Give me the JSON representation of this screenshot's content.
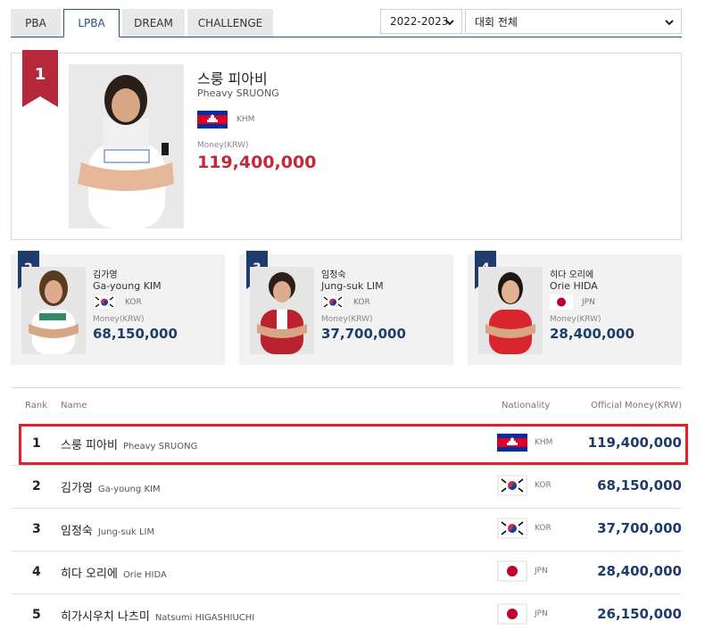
{
  "tabs": [
    {
      "label": "PBA",
      "active": false
    },
    {
      "label": "LPBA",
      "active": true
    },
    {
      "label": "DREAM",
      "active": false
    },
    {
      "label": "CHALLENGE",
      "active": false
    }
  ],
  "filters": {
    "season": "2022-2023",
    "tournament": "대회 전체"
  },
  "money_label": "Money(KRW)",
  "top": [
    {
      "rank": "1",
      "name_ko": "스룽 피아비",
      "name_en": "Pheavy SRUONG",
      "nat": "KHM",
      "money": "119,400,000"
    },
    {
      "rank": "2",
      "name_ko": "김가영",
      "name_en": "Ga-young KIM",
      "nat": "KOR",
      "money": "68,150,000"
    },
    {
      "rank": "3",
      "name_ko": "임정숙",
      "name_en": "Jung-suk LIM",
      "nat": "KOR",
      "money": "37,700,000"
    },
    {
      "rank": "4",
      "name_ko": "히다 오리에",
      "name_en": "Orie HIDA",
      "nat": "JPN",
      "money": "28,400,000"
    }
  ],
  "table": {
    "headers": {
      "rank": "Rank",
      "name": "Name",
      "nationality": "Nationality",
      "money": "Official Money(KRW)"
    },
    "rows": [
      {
        "rank": "1",
        "name_ko": "스룽 피아비",
        "name_en": "Pheavy SRUONG",
        "nat": "KHM",
        "money": "119,400,000"
      },
      {
        "rank": "2",
        "name_ko": "김가영",
        "name_en": "Ga-young KIM",
        "nat": "KOR",
        "money": "68,150,000"
      },
      {
        "rank": "3",
        "name_ko": "임정숙",
        "name_en": "Jung-suk LIM",
        "nat": "KOR",
        "money": "37,700,000"
      },
      {
        "rank": "4",
        "name_ko": "히다 오리에",
        "name_en": "Orie HIDA",
        "nat": "JPN",
        "money": "28,400,000"
      },
      {
        "rank": "5",
        "name_ko": "히가시우치 나츠미",
        "name_en": "Natsumi HIGASHIUCHI",
        "nat": "JPN",
        "money": "26,150,000"
      }
    ]
  },
  "colors": {
    "navy": "#1f3d6b",
    "rank1_red": "#b5283a",
    "money_red": "#c22a3c",
    "highlight": "#e0202a"
  },
  "icons": [
    "khm-flag-icon",
    "kor-flag-icon",
    "jpn-flag-icon",
    "chevron-down-icon"
  ]
}
